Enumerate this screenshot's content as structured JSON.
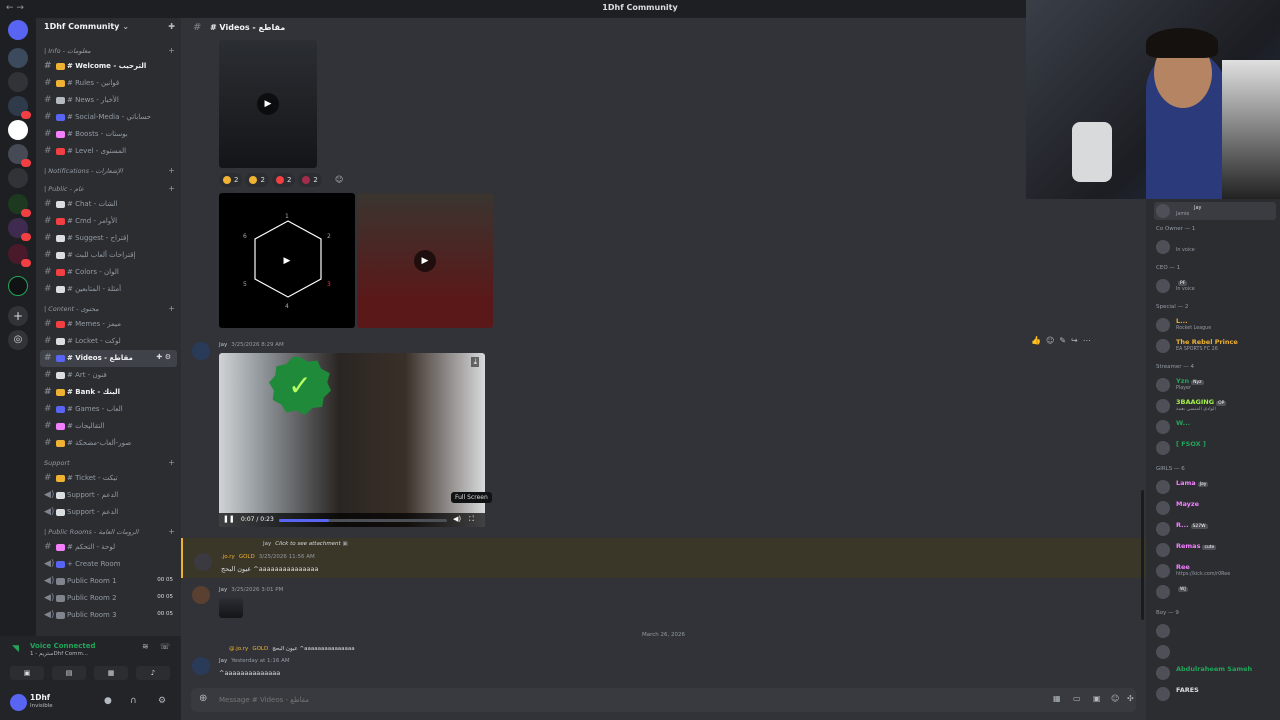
{
  "window": {
    "title": "1Dhf Community",
    "nav": "← →"
  },
  "guild": {
    "name": "1Dhf Community"
  },
  "sidebar": {
    "categories": [
      {
        "label": "| Info - معلومات",
        "channels": [
          {
            "label": "# Welcome - الترحيب",
            "bold": true,
            "color": "#f0b232"
          },
          {
            "label": "# Rules - قوانين",
            "color": "#f0b232"
          },
          {
            "label": "# News - الأخبار",
            "color": "#b5bac1"
          },
          {
            "label": "# Social-Media - حساباتي",
            "color": "#5865f2"
          },
          {
            "label": "# Boosts - بوستات",
            "color": "#f47fff"
          },
          {
            "label": "# Level - المستوى",
            "color": "#f23f43"
          }
        ]
      },
      {
        "label": "| Notifications - الإشعارات",
        "channels": []
      },
      {
        "label": "| Public - عام",
        "channels": [
          {
            "label": "# Chat - الشات",
            "color": "#dbdee1"
          },
          {
            "label": "# Cmd - الأوامر",
            "color": "#f23f43"
          },
          {
            "label": "# Suggest - إقتراح",
            "color": "#dbdee1"
          },
          {
            "label": "# إقتراحات ألعاب للبث",
            "color": "#dbdee1"
          },
          {
            "label": "# Colors - الوان",
            "color": "#f23f43"
          },
          {
            "label": "# أمثلة - المتابعين",
            "color": "#dbdee1"
          }
        ]
      },
      {
        "label": "| Content - محتوى",
        "channels": [
          {
            "label": "# Memes - ميمز",
            "color": "#f23f43"
          },
          {
            "label": "# Locket - لوكت",
            "color": "#dbdee1"
          },
          {
            "label": "# Videos - مقاطع",
            "active": true,
            "color": "#5865f2"
          },
          {
            "label": "# Art - فنون",
            "color": "#dbdee1"
          },
          {
            "label": "# Bank - البنك",
            "bold": true,
            "color": "#f0b232"
          },
          {
            "label": "# Games - العاب",
            "color": "#5865f2"
          },
          {
            "label": "# التقاليجات",
            "color": "#f47fff"
          },
          {
            "label": "# صور-ألعاب-مضحكة",
            "color": "#f0b232"
          }
        ]
      },
      {
        "label": "Support",
        "channels": [
          {
            "label": "# Ticket - تيكت",
            "color": "#f0b232"
          },
          {
            "label": "Support - الدعم",
            "voice": true,
            "color": "#dbdee1"
          },
          {
            "label": "Support - الدعم",
            "voice": true,
            "color": "#dbdee1"
          }
        ]
      },
      {
        "label": "| Public Rooms - الرومات العامة",
        "channels": [
          {
            "label": "# لوحة - التحكم",
            "color": "#f47fff"
          },
          {
            "label": "+ Create Room",
            "voice": true,
            "color": "#5865f2"
          },
          {
            "label": "Public Room 1",
            "voice": true,
            "count": "00 05"
          },
          {
            "label": "Public Room 2",
            "voice": true,
            "count": "00 05"
          },
          {
            "label": "Public Room 3",
            "voice": true,
            "count": "00 05"
          }
        ]
      }
    ]
  },
  "voice": {
    "status": "Voice Connected",
    "channel": "ستريم - 1Dhf Comm..."
  },
  "user": {
    "name": "1Dhf",
    "status": "Invisible"
  },
  "channel": {
    "name": "# Videos - مقاطع",
    "placeholder": "Message # Videos - مقاطع"
  },
  "messages": {
    "reactions": [
      {
        "count": "2",
        "color": "#f0b232"
      },
      {
        "count": "2",
        "color": "#f0b232"
      },
      {
        "count": "2",
        "color": "#f23f43"
      },
      {
        "count": "2",
        "color": "#a12d4a"
      }
    ],
    "hex_numbers": [
      "1",
      "2",
      "3",
      "4",
      "5",
      "6"
    ],
    "video": {
      "time": "0:07 / 0:23",
      "progress": 0.3,
      "tooltip": "Full Screen"
    },
    "msg1": {
      "author": "Jay",
      "time": "3/25/2026 8:29 AM"
    },
    "reply": {
      "author": "Jay",
      "text": "Click to see attachment"
    },
    "msg2": {
      "author": ".jo.ry",
      "role": "GOLD",
      "time": "3/25/2026 11:56 AM",
      "text": "عيون البحج ^aaaaaaaaaaaaaaa"
    },
    "msg3": {
      "author": "Jay",
      "time": "3/25/2026 3:01 PM"
    },
    "date_divider": "March 26, 2026",
    "reply2": {
      "author": "@.jo.ry",
      "role": "GOLD",
      "text": "عيون البحج ^aaaaaaaaaaaaaaa"
    },
    "msg4": {
      "author": "Jay",
      "time": "Yesterday at 1:16 AM",
      "text": "^aaaaaaaaaaaaaa"
    }
  },
  "members": {
    "groups": [
      {
        "label": "Co Owner — 1",
        "members": [
          {
            "name": "",
            "activity": "In voice",
            "color": "#f23f43"
          }
        ]
      },
      {
        "label": "CEO — 1",
        "members": [
          {
            "name": "",
            "activity": "In voice",
            "color": "#f23f43",
            "tag": "PF"
          }
        ]
      },
      {
        "label": "Special — 2",
        "members": [
          {
            "name": "L...",
            "activity": "Rocket League",
            "color": "#f0b232"
          },
          {
            "name": "The Rebel Prince",
            "activity": "EA SPORTS FC 26",
            "color": "#f0b232"
          }
        ]
      },
      {
        "label": "Streamer — 4",
        "members": [
          {
            "name": "Yzn",
            "activity": "Player",
            "color": "#23a55a",
            "tag": "Nyz"
          },
          {
            "name": "3BAAGING",
            "activity": "الوادي المنسي بعمة",
            "color": "#a5f04b",
            "tag": "OP"
          },
          {
            "name": "W...",
            "activity": "",
            "color": "#23a55a"
          },
          {
            "name": "[ FSOX ]",
            "activity": "",
            "color": "#23a55a"
          }
        ]
      },
      {
        "label": "GIRLS — 6",
        "members": [
          {
            "name": "Lama",
            "activity": "",
            "color": "#f47fff",
            "tag": "Jay"
          },
          {
            "name": "Mayze",
            "activity": "",
            "color": "#f47fff"
          },
          {
            "name": "R...",
            "activity": "",
            "color": "#f47fff",
            "tag": "S27W"
          },
          {
            "name": "Remas",
            "activity": "",
            "color": "#f47fff",
            "tag": "cute"
          },
          {
            "name": "Ree",
            "activity": "https://kick.com/r0Ree",
            "color": "#f47fff"
          },
          {
            "name": "",
            "activity": "",
            "color": "#f47fff",
            "tag": "WJ"
          }
        ]
      },
      {
        "label": "Boy — 9",
        "members": [
          {
            "name": "",
            "activity": "",
            "color": "#dbdee1"
          },
          {
            "name": "",
            "activity": "",
            "color": "#dbdee1"
          },
          {
            "name": "Abdulraheem Sameh",
            "activity": "",
            "color": "#23a55a"
          },
          {
            "name": "FARES",
            "activity": "",
            "color": "#dbdee1"
          }
        ]
      }
    ],
    "top_member": {
      "name": "Jay",
      "activity": "Jamie"
    }
  },
  "webcam": {
    "label": "streamer webcam"
  }
}
